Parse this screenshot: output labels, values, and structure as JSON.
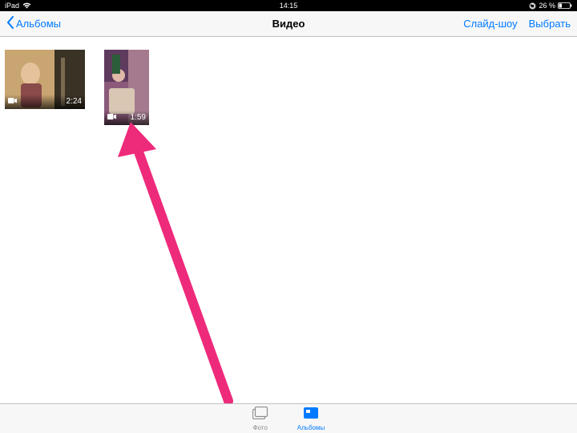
{
  "status": {
    "device": "iPad",
    "time": "14:15",
    "battery": "26 %"
  },
  "nav": {
    "back": "Альбомы",
    "title": "Видео",
    "slideshow": "Слайд-шоу",
    "select": "Выбрать"
  },
  "videos": [
    {
      "duration": "2:24"
    },
    {
      "duration": "1:59"
    }
  ],
  "tabs": {
    "photos": "Фото",
    "albums": "Альбомы"
  },
  "colors": {
    "tint": "#007aff",
    "arrow": "#e91e63"
  }
}
